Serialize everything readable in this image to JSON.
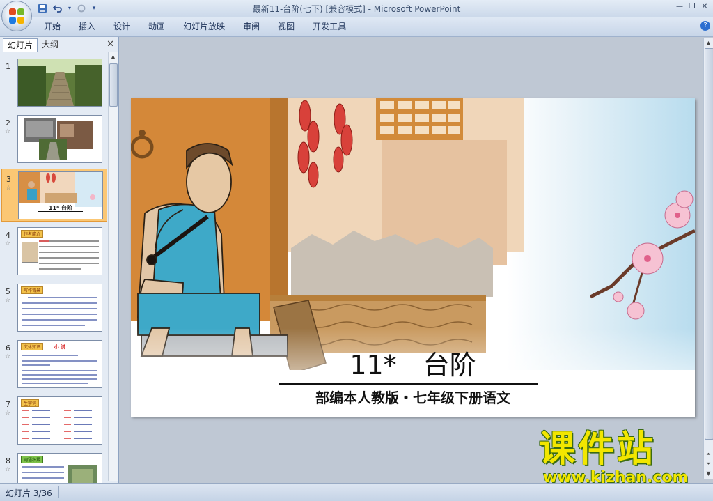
{
  "window": {
    "title": "最新11-台阶(七下) [兼容模式] - Microsoft PowerPoint"
  },
  "ribbon": {
    "tabs": [
      "开始",
      "插入",
      "设计",
      "动画",
      "幻灯片放映",
      "审阅",
      "视图",
      "开发工具"
    ]
  },
  "panel": {
    "tab_slides": "幻灯片",
    "tab_outline": "大纲",
    "close_icon": "close-icon"
  },
  "thumbnails": [
    {
      "num": "1",
      "star": ""
    },
    {
      "num": "2",
      "star": "☆"
    },
    {
      "num": "3",
      "star": "☆",
      "title": "11*  台阶",
      "selected": true
    },
    {
      "num": "4",
      "star": "☆",
      "heading": "作者简介"
    },
    {
      "num": "5",
      "star": "☆",
      "heading": "写作背景"
    },
    {
      "num": "6",
      "star": "☆",
      "heading": "文体知识",
      "sub": "小 说"
    },
    {
      "num": "7",
      "star": "☆",
      "heading": "生字词"
    },
    {
      "num": "8",
      "star": "☆",
      "heading": "词语积累"
    }
  ],
  "slide": {
    "title": "11*　台阶",
    "subtitle": "部编本人教版・七年级下册语文"
  },
  "status": {
    "text": "幻灯片 3/36"
  },
  "watermark": {
    "main": "课件站",
    "url": "www.kjzhan.com"
  },
  "colors": {
    "selection": "#fbc774",
    "ribbon": "#dfe8f4",
    "watermark": "#f2e600"
  }
}
